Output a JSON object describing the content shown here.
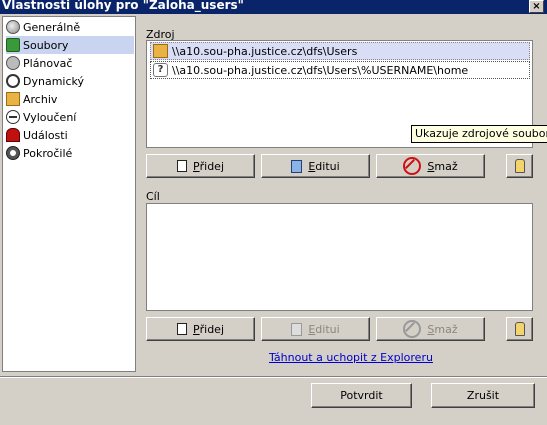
{
  "window": {
    "title": "Vlastnosti úlohy pro \"Zaloha_users\"",
    "close_label": "×"
  },
  "sidebar": {
    "items": [
      {
        "label": "Generálně",
        "icon": "general-icon"
      },
      {
        "label": "Soubory",
        "icon": "files-icon"
      },
      {
        "label": "Plánovač",
        "icon": "scheduler-icon"
      },
      {
        "label": "Dynamický",
        "icon": "dynamic-icon"
      },
      {
        "label": "Archiv",
        "icon": "archive-icon"
      },
      {
        "label": "Vyloučení",
        "icon": "exclusion-icon"
      },
      {
        "label": "Události",
        "icon": "events-icon"
      },
      {
        "label": "Pokročilé",
        "icon": "advanced-icon"
      }
    ],
    "selected_index": 1
  },
  "source": {
    "label": "Zdroj",
    "entries": [
      {
        "path": "\\\\a10.sou-pha.justice.cz\\dfs\\Users",
        "icon": "folder-icon"
      },
      {
        "path": "\\\\a10.sou-pha.justice.cz\\dfs\\Users\\%USERNAME\\home",
        "icon": "unknown-path-icon"
      }
    ],
    "buttons": {
      "add": {
        "key": "P",
        "rest": "řidej"
      },
      "edit": {
        "key": "E",
        "rest": "ditui"
      },
      "delete": {
        "key": "S",
        "rest": "maž"
      }
    }
  },
  "tooltip": {
    "text": "Ukazuje zdrojové soubory n"
  },
  "target": {
    "label": "Cíl",
    "entries": [],
    "buttons": {
      "add": {
        "key": "P",
        "rest": "řidej"
      },
      "edit": {
        "key": "E",
        "rest": "ditui"
      },
      "delete": {
        "key": "S",
        "rest": "maž"
      }
    }
  },
  "drag_hint": "Táhnout a uchopit z Exploreru",
  "footer": {
    "confirm_label": "Potvrdit",
    "cancel_label": "Zrušit"
  }
}
